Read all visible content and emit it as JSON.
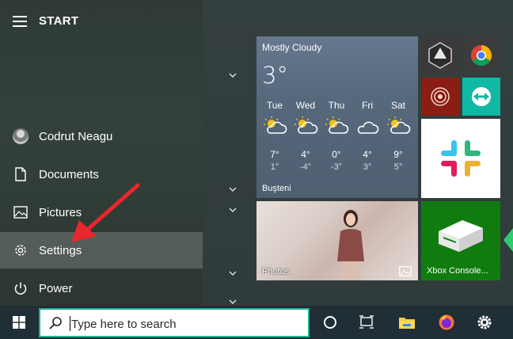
{
  "start_menu": {
    "title": "START",
    "items": [
      {
        "label": "Codrut Neagu",
        "icon": "user-avatar"
      },
      {
        "label": "Documents",
        "icon": "document-icon"
      },
      {
        "label": "Pictures",
        "icon": "picture-icon"
      },
      {
        "label": "Settings",
        "icon": "gear-icon",
        "selected": true
      },
      {
        "label": "Power",
        "icon": "power-icon"
      }
    ]
  },
  "tiles": {
    "weather": {
      "condition": "Mostly Cloudy",
      "current_temp": "3°",
      "location": "Buşteni",
      "forecast": [
        {
          "day": "Tue",
          "hi": "7°",
          "lo": "1°"
        },
        {
          "day": "Wed",
          "hi": "4°",
          "lo": "-4°"
        },
        {
          "day": "Thu",
          "hi": "0°",
          "lo": "-3°"
        },
        {
          "day": "Fri",
          "hi": "4°",
          "lo": "3°"
        },
        {
          "day": "Sat",
          "hi": "9°",
          "lo": "5°"
        }
      ]
    },
    "photos": {
      "label": "Photos"
    },
    "xbox": {
      "label": "Xbox Console..."
    },
    "small": [
      "app-tile-icon",
      "chrome-icon",
      "radar-app-icon",
      "teamviewer-icon"
    ],
    "slack": {
      "icon": "slack-icon"
    }
  },
  "taskbar": {
    "search_placeholder": "Type here to search",
    "icons": [
      "cortana-icon",
      "task-view-icon",
      "file-explorer-icon",
      "firefox-icon",
      "settings-gear-icon"
    ]
  },
  "colors": {
    "search_border": "#1ab394",
    "xbox_tile": "#107c10",
    "arrow": "#e8272c"
  }
}
